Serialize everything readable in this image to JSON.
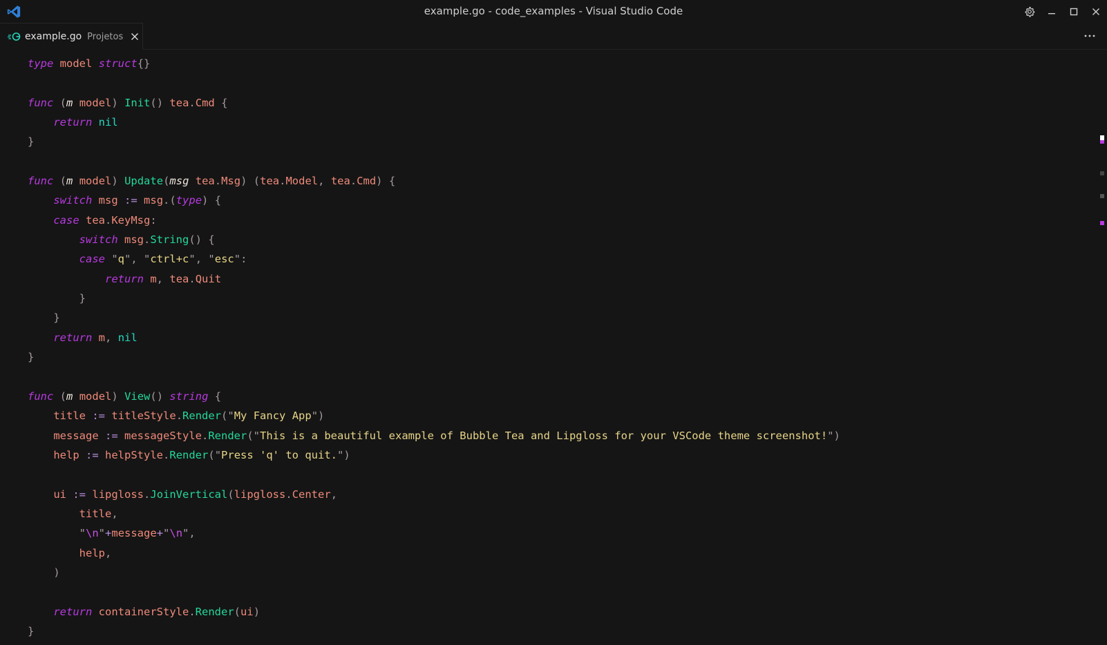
{
  "window": {
    "title": "example.go - code_examples - Visual Studio Code"
  },
  "tabs": [
    {
      "name": "example.go",
      "description": "Projetos",
      "active": true
    }
  ],
  "icons": {
    "app": "vscode-logo-icon",
    "file": "go-file-icon",
    "close": "close-icon",
    "settings": "gear-icon",
    "minimize": "minimize-icon",
    "maximize": "maximize-icon",
    "window_close": "window-close-icon",
    "more": "ellipsis-icon"
  },
  "colors": {
    "background": "#151515",
    "keyword": "#b83ae0",
    "function": "#24d89a",
    "string": "#e7d488",
    "variable": "#ef8a7a",
    "accent": "#2f7fd6"
  },
  "code": [
    [
      [
        "kw",
        "type"
      ],
      [
        "p",
        " "
      ],
      [
        "var",
        "model"
      ],
      [
        "p",
        " "
      ],
      [
        "kw",
        "struct"
      ],
      [
        "punc",
        "{}"
      ]
    ],
    [],
    [
      [
        "kw",
        "func"
      ],
      [
        "p",
        " "
      ],
      [
        "punc",
        "("
      ],
      [
        "param",
        "m"
      ],
      [
        "p",
        " "
      ],
      [
        "var",
        "model"
      ],
      [
        "punc",
        ")"
      ],
      [
        "p",
        " "
      ],
      [
        "fn",
        "Init"
      ],
      [
        "punc",
        "()"
      ],
      [
        "p",
        " "
      ],
      [
        "var",
        "tea"
      ],
      [
        "punc",
        "."
      ],
      [
        "var",
        "Cmd"
      ],
      [
        "p",
        " "
      ],
      [
        "punc",
        "{"
      ]
    ],
    [
      [
        "p",
        "    "
      ],
      [
        "kw",
        "return"
      ],
      [
        "p",
        " "
      ],
      [
        "nil",
        "nil"
      ]
    ],
    [
      [
        "punc",
        "}"
      ]
    ],
    [],
    [
      [
        "kw",
        "func"
      ],
      [
        "p",
        " "
      ],
      [
        "punc",
        "("
      ],
      [
        "param",
        "m"
      ],
      [
        "p",
        " "
      ],
      [
        "var",
        "model"
      ],
      [
        "punc",
        ")"
      ],
      [
        "p",
        " "
      ],
      [
        "fn",
        "Update"
      ],
      [
        "punc",
        "("
      ],
      [
        "param",
        "msg"
      ],
      [
        "p",
        " "
      ],
      [
        "var",
        "tea"
      ],
      [
        "punc",
        "."
      ],
      [
        "var",
        "Msg"
      ],
      [
        "punc",
        ")"
      ],
      [
        "p",
        " "
      ],
      [
        "punc",
        "("
      ],
      [
        "var",
        "tea"
      ],
      [
        "punc",
        "."
      ],
      [
        "var",
        "Model"
      ],
      [
        "punc",
        ","
      ],
      [
        "p",
        " "
      ],
      [
        "var",
        "tea"
      ],
      [
        "punc",
        "."
      ],
      [
        "var",
        "Cmd"
      ],
      [
        "punc",
        ")"
      ],
      [
        "p",
        " "
      ],
      [
        "punc",
        "{"
      ]
    ],
    [
      [
        "p",
        "    "
      ],
      [
        "kw",
        "switch"
      ],
      [
        "p",
        " "
      ],
      [
        "var",
        "msg"
      ],
      [
        "p",
        " "
      ],
      [
        "op",
        ":="
      ],
      [
        "p",
        " "
      ],
      [
        "var",
        "msg"
      ],
      [
        "punc",
        ".("
      ],
      [
        "kw",
        "type"
      ],
      [
        "punc",
        ")"
      ],
      [
        "p",
        " "
      ],
      [
        "punc",
        "{"
      ]
    ],
    [
      [
        "p",
        "    "
      ],
      [
        "kw",
        "case"
      ],
      [
        "p",
        " "
      ],
      [
        "var",
        "tea"
      ],
      [
        "punc",
        "."
      ],
      [
        "var",
        "KeyMsg"
      ],
      [
        "punc",
        ":"
      ]
    ],
    [
      [
        "p",
        "        "
      ],
      [
        "kw",
        "switch"
      ],
      [
        "p",
        " "
      ],
      [
        "var",
        "msg"
      ],
      [
        "punc",
        "."
      ],
      [
        "fn",
        "String"
      ],
      [
        "punc",
        "()"
      ],
      [
        "p",
        " "
      ],
      [
        "punc",
        "{"
      ]
    ],
    [
      [
        "p",
        "        "
      ],
      [
        "kw",
        "case"
      ],
      [
        "p",
        " "
      ],
      [
        "punc",
        "\""
      ],
      [
        "str",
        "q"
      ],
      [
        "punc",
        "\""
      ],
      [
        "punc",
        ","
      ],
      [
        "p",
        " "
      ],
      [
        "punc",
        "\""
      ],
      [
        "str",
        "ctrl+c"
      ],
      [
        "punc",
        "\""
      ],
      [
        "punc",
        ","
      ],
      [
        "p",
        " "
      ],
      [
        "punc",
        "\""
      ],
      [
        "str",
        "esc"
      ],
      [
        "punc",
        "\""
      ],
      [
        "punc",
        ":"
      ]
    ],
    [
      [
        "p",
        "            "
      ],
      [
        "kw",
        "return"
      ],
      [
        "p",
        " "
      ],
      [
        "var",
        "m"
      ],
      [
        "punc",
        ","
      ],
      [
        "p",
        " "
      ],
      [
        "var",
        "tea"
      ],
      [
        "punc",
        "."
      ],
      [
        "var",
        "Quit"
      ]
    ],
    [
      [
        "p",
        "        "
      ],
      [
        "punc",
        "}"
      ]
    ],
    [
      [
        "p",
        "    "
      ],
      [
        "punc",
        "}"
      ]
    ],
    [
      [
        "p",
        "    "
      ],
      [
        "kw",
        "return"
      ],
      [
        "p",
        " "
      ],
      [
        "var",
        "m"
      ],
      [
        "punc",
        ","
      ],
      [
        "p",
        " "
      ],
      [
        "nil",
        "nil"
      ]
    ],
    [
      [
        "punc",
        "}"
      ]
    ],
    [],
    [
      [
        "kw",
        "func"
      ],
      [
        "p",
        " "
      ],
      [
        "punc",
        "("
      ],
      [
        "param",
        "m"
      ],
      [
        "p",
        " "
      ],
      [
        "var",
        "model"
      ],
      [
        "punc",
        ")"
      ],
      [
        "p",
        " "
      ],
      [
        "fn",
        "View"
      ],
      [
        "punc",
        "()"
      ],
      [
        "p",
        " "
      ],
      [
        "kw",
        "string"
      ],
      [
        "p",
        " "
      ],
      [
        "punc",
        "{"
      ]
    ],
    [
      [
        "p",
        "    "
      ],
      [
        "var",
        "title"
      ],
      [
        "p",
        " "
      ],
      [
        "op",
        ":="
      ],
      [
        "p",
        " "
      ],
      [
        "var",
        "titleStyle"
      ],
      [
        "punc",
        "."
      ],
      [
        "fn",
        "Render"
      ],
      [
        "punc",
        "(\""
      ],
      [
        "str",
        "My Fancy App"
      ],
      [
        "punc",
        "\")"
      ]
    ],
    [
      [
        "p",
        "    "
      ],
      [
        "var",
        "message"
      ],
      [
        "p",
        " "
      ],
      [
        "op",
        ":="
      ],
      [
        "p",
        " "
      ],
      [
        "var",
        "messageStyle"
      ],
      [
        "punc",
        "."
      ],
      [
        "fn",
        "Render"
      ],
      [
        "punc",
        "(\""
      ],
      [
        "str",
        "This is a beautiful example of Bubble Tea and Lipgloss for your VSCode theme screenshot!"
      ],
      [
        "punc",
        "\")"
      ]
    ],
    [
      [
        "p",
        "    "
      ],
      [
        "var",
        "help"
      ],
      [
        "p",
        " "
      ],
      [
        "op",
        ":="
      ],
      [
        "p",
        " "
      ],
      [
        "var",
        "helpStyle"
      ],
      [
        "punc",
        "."
      ],
      [
        "fn",
        "Render"
      ],
      [
        "punc",
        "(\""
      ],
      [
        "str",
        "Press 'q' to quit."
      ],
      [
        "punc",
        "\")"
      ]
    ],
    [],
    [
      [
        "p",
        "    "
      ],
      [
        "var",
        "ui"
      ],
      [
        "p",
        " "
      ],
      [
        "op",
        ":="
      ],
      [
        "p",
        " "
      ],
      [
        "var",
        "lipgloss"
      ],
      [
        "punc",
        "."
      ],
      [
        "fn",
        "JoinVertical"
      ],
      [
        "punc",
        "("
      ],
      [
        "var",
        "lipgloss"
      ],
      [
        "punc",
        "."
      ],
      [
        "var",
        "Center"
      ],
      [
        "punc",
        ","
      ]
    ],
    [
      [
        "p",
        "        "
      ],
      [
        "var",
        "title"
      ],
      [
        "punc",
        ","
      ]
    ],
    [
      [
        "p",
        "        "
      ],
      [
        "punc",
        "\""
      ],
      [
        "esc",
        "\\n"
      ],
      [
        "punc",
        "\""
      ],
      [
        "op",
        "+"
      ],
      [
        "var",
        "message"
      ],
      [
        "op",
        "+"
      ],
      [
        "punc",
        "\""
      ],
      [
        "esc",
        "\\n"
      ],
      [
        "punc",
        "\""
      ],
      [
        "punc",
        ","
      ]
    ],
    [
      [
        "p",
        "        "
      ],
      [
        "var",
        "help"
      ],
      [
        "punc",
        ","
      ]
    ],
    [
      [
        "p",
        "    "
      ],
      [
        "punc",
        ")"
      ]
    ],
    [],
    [
      [
        "p",
        "    "
      ],
      [
        "kw",
        "return"
      ],
      [
        "p",
        " "
      ],
      [
        "var",
        "containerStyle"
      ],
      [
        "punc",
        "."
      ],
      [
        "fn",
        "Render"
      ],
      [
        "punc",
        "("
      ],
      [
        "var",
        "ui"
      ],
      [
        "punc",
        ")"
      ]
    ],
    [
      [
        "punc",
        "}"
      ]
    ]
  ]
}
